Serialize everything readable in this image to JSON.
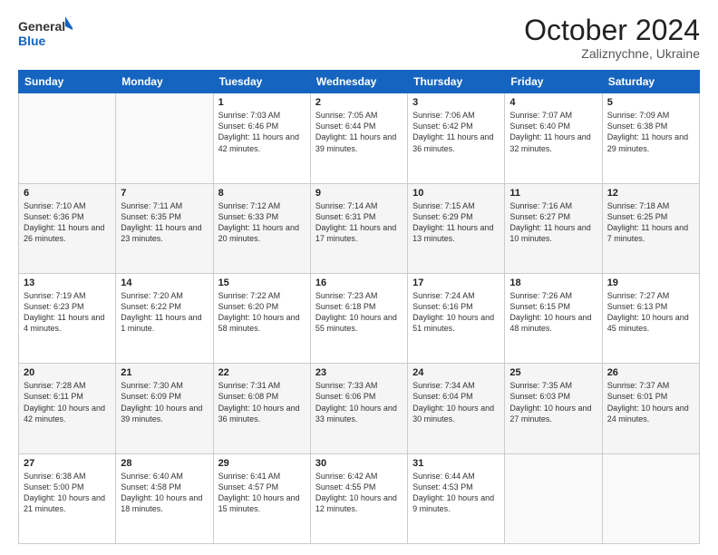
{
  "header": {
    "logo_line1": "General",
    "logo_line2": "Blue",
    "month": "October 2024",
    "location": "Zaliznychne, Ukraine"
  },
  "weekdays": [
    "Sunday",
    "Monday",
    "Tuesday",
    "Wednesday",
    "Thursday",
    "Friday",
    "Saturday"
  ],
  "weeks": [
    [
      {
        "day": "",
        "sunrise": "",
        "sunset": "",
        "daylight": ""
      },
      {
        "day": "",
        "sunrise": "",
        "sunset": "",
        "daylight": ""
      },
      {
        "day": "1",
        "sunrise": "Sunrise: 7:03 AM",
        "sunset": "Sunset: 6:46 PM",
        "daylight": "Daylight: 11 hours and 42 minutes."
      },
      {
        "day": "2",
        "sunrise": "Sunrise: 7:05 AM",
        "sunset": "Sunset: 6:44 PM",
        "daylight": "Daylight: 11 hours and 39 minutes."
      },
      {
        "day": "3",
        "sunrise": "Sunrise: 7:06 AM",
        "sunset": "Sunset: 6:42 PM",
        "daylight": "Daylight: 11 hours and 36 minutes."
      },
      {
        "day": "4",
        "sunrise": "Sunrise: 7:07 AM",
        "sunset": "Sunset: 6:40 PM",
        "daylight": "Daylight: 11 hours and 32 minutes."
      },
      {
        "day": "5",
        "sunrise": "Sunrise: 7:09 AM",
        "sunset": "Sunset: 6:38 PM",
        "daylight": "Daylight: 11 hours and 29 minutes."
      }
    ],
    [
      {
        "day": "6",
        "sunrise": "Sunrise: 7:10 AM",
        "sunset": "Sunset: 6:36 PM",
        "daylight": "Daylight: 11 hours and 26 minutes."
      },
      {
        "day": "7",
        "sunrise": "Sunrise: 7:11 AM",
        "sunset": "Sunset: 6:35 PM",
        "daylight": "Daylight: 11 hours and 23 minutes."
      },
      {
        "day": "8",
        "sunrise": "Sunrise: 7:12 AM",
        "sunset": "Sunset: 6:33 PM",
        "daylight": "Daylight: 11 hours and 20 minutes."
      },
      {
        "day": "9",
        "sunrise": "Sunrise: 7:14 AM",
        "sunset": "Sunset: 6:31 PM",
        "daylight": "Daylight: 11 hours and 17 minutes."
      },
      {
        "day": "10",
        "sunrise": "Sunrise: 7:15 AM",
        "sunset": "Sunset: 6:29 PM",
        "daylight": "Daylight: 11 hours and 13 minutes."
      },
      {
        "day": "11",
        "sunrise": "Sunrise: 7:16 AM",
        "sunset": "Sunset: 6:27 PM",
        "daylight": "Daylight: 11 hours and 10 minutes."
      },
      {
        "day": "12",
        "sunrise": "Sunrise: 7:18 AM",
        "sunset": "Sunset: 6:25 PM",
        "daylight": "Daylight: 11 hours and 7 minutes."
      }
    ],
    [
      {
        "day": "13",
        "sunrise": "Sunrise: 7:19 AM",
        "sunset": "Sunset: 6:23 PM",
        "daylight": "Daylight: 11 hours and 4 minutes."
      },
      {
        "day": "14",
        "sunrise": "Sunrise: 7:20 AM",
        "sunset": "Sunset: 6:22 PM",
        "daylight": "Daylight: 11 hours and 1 minute."
      },
      {
        "day": "15",
        "sunrise": "Sunrise: 7:22 AM",
        "sunset": "Sunset: 6:20 PM",
        "daylight": "Daylight: 10 hours and 58 minutes."
      },
      {
        "day": "16",
        "sunrise": "Sunrise: 7:23 AM",
        "sunset": "Sunset: 6:18 PM",
        "daylight": "Daylight: 10 hours and 55 minutes."
      },
      {
        "day": "17",
        "sunrise": "Sunrise: 7:24 AM",
        "sunset": "Sunset: 6:16 PM",
        "daylight": "Daylight: 10 hours and 51 minutes."
      },
      {
        "day": "18",
        "sunrise": "Sunrise: 7:26 AM",
        "sunset": "Sunset: 6:15 PM",
        "daylight": "Daylight: 10 hours and 48 minutes."
      },
      {
        "day": "19",
        "sunrise": "Sunrise: 7:27 AM",
        "sunset": "Sunset: 6:13 PM",
        "daylight": "Daylight: 10 hours and 45 minutes."
      }
    ],
    [
      {
        "day": "20",
        "sunrise": "Sunrise: 7:28 AM",
        "sunset": "Sunset: 6:11 PM",
        "daylight": "Daylight: 10 hours and 42 minutes."
      },
      {
        "day": "21",
        "sunrise": "Sunrise: 7:30 AM",
        "sunset": "Sunset: 6:09 PM",
        "daylight": "Daylight: 10 hours and 39 minutes."
      },
      {
        "day": "22",
        "sunrise": "Sunrise: 7:31 AM",
        "sunset": "Sunset: 6:08 PM",
        "daylight": "Daylight: 10 hours and 36 minutes."
      },
      {
        "day": "23",
        "sunrise": "Sunrise: 7:33 AM",
        "sunset": "Sunset: 6:06 PM",
        "daylight": "Daylight: 10 hours and 33 minutes."
      },
      {
        "day": "24",
        "sunrise": "Sunrise: 7:34 AM",
        "sunset": "Sunset: 6:04 PM",
        "daylight": "Daylight: 10 hours and 30 minutes."
      },
      {
        "day": "25",
        "sunrise": "Sunrise: 7:35 AM",
        "sunset": "Sunset: 6:03 PM",
        "daylight": "Daylight: 10 hours and 27 minutes."
      },
      {
        "day": "26",
        "sunrise": "Sunrise: 7:37 AM",
        "sunset": "Sunset: 6:01 PM",
        "daylight": "Daylight: 10 hours and 24 minutes."
      }
    ],
    [
      {
        "day": "27",
        "sunrise": "Sunrise: 6:38 AM",
        "sunset": "Sunset: 5:00 PM",
        "daylight": "Daylight: 10 hours and 21 minutes."
      },
      {
        "day": "28",
        "sunrise": "Sunrise: 6:40 AM",
        "sunset": "Sunset: 4:58 PM",
        "daylight": "Daylight: 10 hours and 18 minutes."
      },
      {
        "day": "29",
        "sunrise": "Sunrise: 6:41 AM",
        "sunset": "Sunset: 4:57 PM",
        "daylight": "Daylight: 10 hours and 15 minutes."
      },
      {
        "day": "30",
        "sunrise": "Sunrise: 6:42 AM",
        "sunset": "Sunset: 4:55 PM",
        "daylight": "Daylight: 10 hours and 12 minutes."
      },
      {
        "day": "31",
        "sunrise": "Sunrise: 6:44 AM",
        "sunset": "Sunset: 4:53 PM",
        "daylight": "Daylight: 10 hours and 9 minutes."
      },
      {
        "day": "",
        "sunrise": "",
        "sunset": "",
        "daylight": ""
      },
      {
        "day": "",
        "sunrise": "",
        "sunset": "",
        "daylight": ""
      }
    ]
  ]
}
